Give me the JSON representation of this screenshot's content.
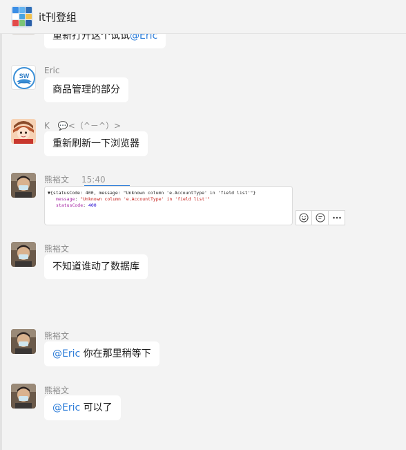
{
  "header": {
    "title": "it刊登组",
    "avatar_colors": [
      "#3a8ee6",
      "#63b4f0",
      "#2f6fb7",
      "#ffffff",
      "#4aa3df",
      "#f2c14e",
      "#e34b4b",
      "#7cc576",
      "#2a5fa8"
    ]
  },
  "messages": [
    {
      "id": "m0",
      "sender": "",
      "time": "",
      "parts": [
        {
          "text": "重新打开这个试试",
          "mention": false
        },
        {
          "text": "@Eric",
          "mention": true
        }
      ]
    },
    {
      "id": "m1",
      "sender": "Eric",
      "time": "",
      "parts": [
        {
          "text": "商品管理的部分",
          "mention": false
        }
      ]
    },
    {
      "id": "m2",
      "sender": "K　💬<（^－^）>",
      "time": "",
      "parts": [
        {
          "text": "重新刷新一下浏览器",
          "mention": false
        }
      ]
    },
    {
      "id": "m3",
      "sender": "熊裕文",
      "time": "15:40",
      "code": {
        "line1": "▼{statusCode: 400, message: \"Unknown column 'e.AccountType' in 'field list'\"}",
        "line2_key": "message",
        "line2_val": "\"Unknown column 'e.AccountType' in 'field list'\"",
        "line3_key": "statusCode",
        "line3_val": "400"
      }
    },
    {
      "id": "m4",
      "sender": "熊裕文",
      "time": "",
      "parts": [
        {
          "text": "不知道谁动了数据库",
          "mention": false
        }
      ]
    },
    {
      "id": "m5",
      "sender": "熊裕文",
      "time": "",
      "parts": [
        {
          "text": "@Eric",
          "mention": true
        },
        {
          "text": " 你在那里稍等下",
          "mention": false
        }
      ]
    },
    {
      "id": "m6",
      "sender": "熊裕文",
      "time": "",
      "parts": [
        {
          "text": "@Eric",
          "mention": true
        },
        {
          "text": " 可以了",
          "mention": false
        }
      ]
    }
  ],
  "tools": [
    "emoji-icon",
    "reply-icon",
    "more-icon"
  ]
}
